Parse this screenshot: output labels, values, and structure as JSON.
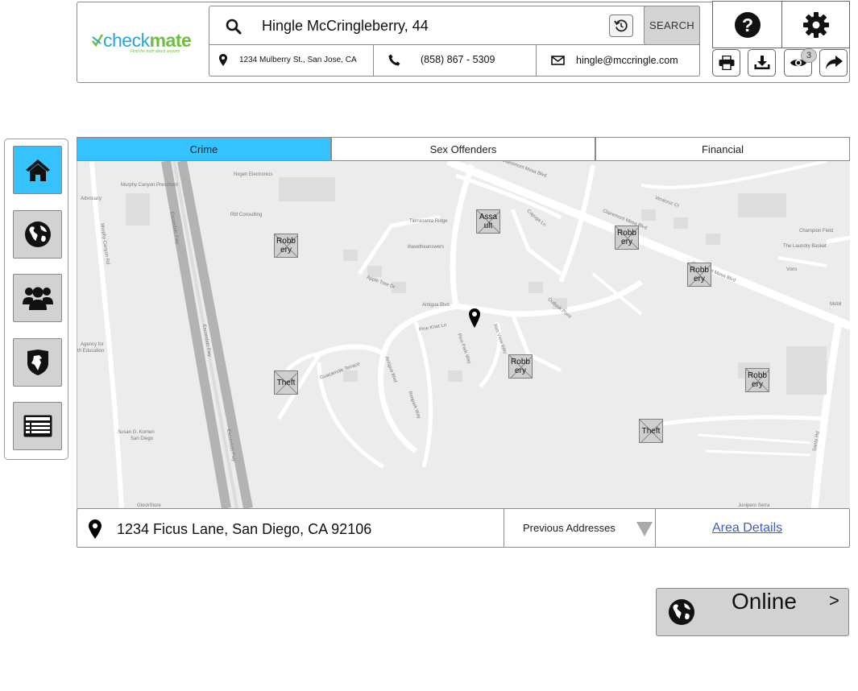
{
  "brand": {
    "logo_part1": "checkmate",
    "tagline": "Find the truth about anyone",
    "color_primary": "#2ba3d8",
    "color_secondary": "#6cbf3f"
  },
  "search": {
    "query": "Hingle McCringleberry, 44",
    "button_label": "SEARCH"
  },
  "person": {
    "address": "1234 Mulberry St., San Jose, CA",
    "phone": "(858) 867 - 5309",
    "email": "hingle@mccringle.com"
  },
  "toolbar": {
    "views_count": "3"
  },
  "tabs": [
    {
      "label": "Crime",
      "active": true
    },
    {
      "label": "Sex Offenders",
      "active": false
    },
    {
      "label": "Financial",
      "active": false
    }
  ],
  "map": {
    "labels": {
      "nxgen": "Nxgen Electronics",
      "murphy_preschool": "Murphy Canyon Preschool",
      "advocacy": "Advocacy",
      "rbf": "Rbf Consulting",
      "tierrasanta": "Tierrasanta Ridge",
      "ihave": "ihavetheanswers",
      "champion": "Champion Field",
      "laundry": "The Laundry Basket",
      "vons": "Vons",
      "mobil": "Mobil",
      "agency": "Agency for",
      "agency2": "th Education",
      "susan": "Susan G. Komen",
      "susan2": "San Diego",
      "glockstore": "GlockStore",
      "junipero": "Junipero Serra",
      "clairemont1": "Clairemont Mesa Blvd",
      "clairemont2": "Clairemont Mesa Blvd",
      "clairemont3": "Clairemont Mesa Blvd",
      "escondido1": "Escondido Fwy",
      "escondido2": "Escondido Fwy",
      "escondido3": "Escondido Fwy",
      "murphy_rd": "Murphy Canyon Rd",
      "antigua1": "Antigua Blvd",
      "antigua2": "Antigua Blvd",
      "santo": "Santo Rd",
      "apple_tree": "Apple Tree Dr",
      "pine_knot": "Pine Knot Ln",
      "rim_view": "Rim View Way",
      "rimpark": "Rimpark Way",
      "guacamole": "Guacamole Terrace",
      "outlook": "Outlook Point",
      "veracruz": "Veracruz Ct",
      "cayuga": "Cayuga Ln",
      "pine_park": "Pine Park Way"
    },
    "crimes": [
      {
        "type": "Assault",
        "text": "Assa ult"
      },
      {
        "type": "Robbery",
        "text": "Robb ery"
      },
      {
        "type": "Robbery",
        "text": "Robb ery"
      },
      {
        "type": "Robbery",
        "text": "Robb ery"
      },
      {
        "type": "Theft",
        "text": "Theft"
      },
      {
        "type": "Robbery",
        "text": "Robb ery"
      },
      {
        "type": "Robbery",
        "text": "Robb ery"
      },
      {
        "type": "Theft",
        "text": "Theft"
      }
    ]
  },
  "address_bar": {
    "address": "1234 Ficus Lane, San Diego, CA 92106",
    "previous_label": "Previous Addresses",
    "area_details": "Area Details"
  },
  "online": {
    "label": "Online",
    "arrow": ">"
  },
  "colors": {
    "active_tab": "#36c2ff",
    "button_gray": "#d2d2d2",
    "link": "#3b5bdb"
  }
}
